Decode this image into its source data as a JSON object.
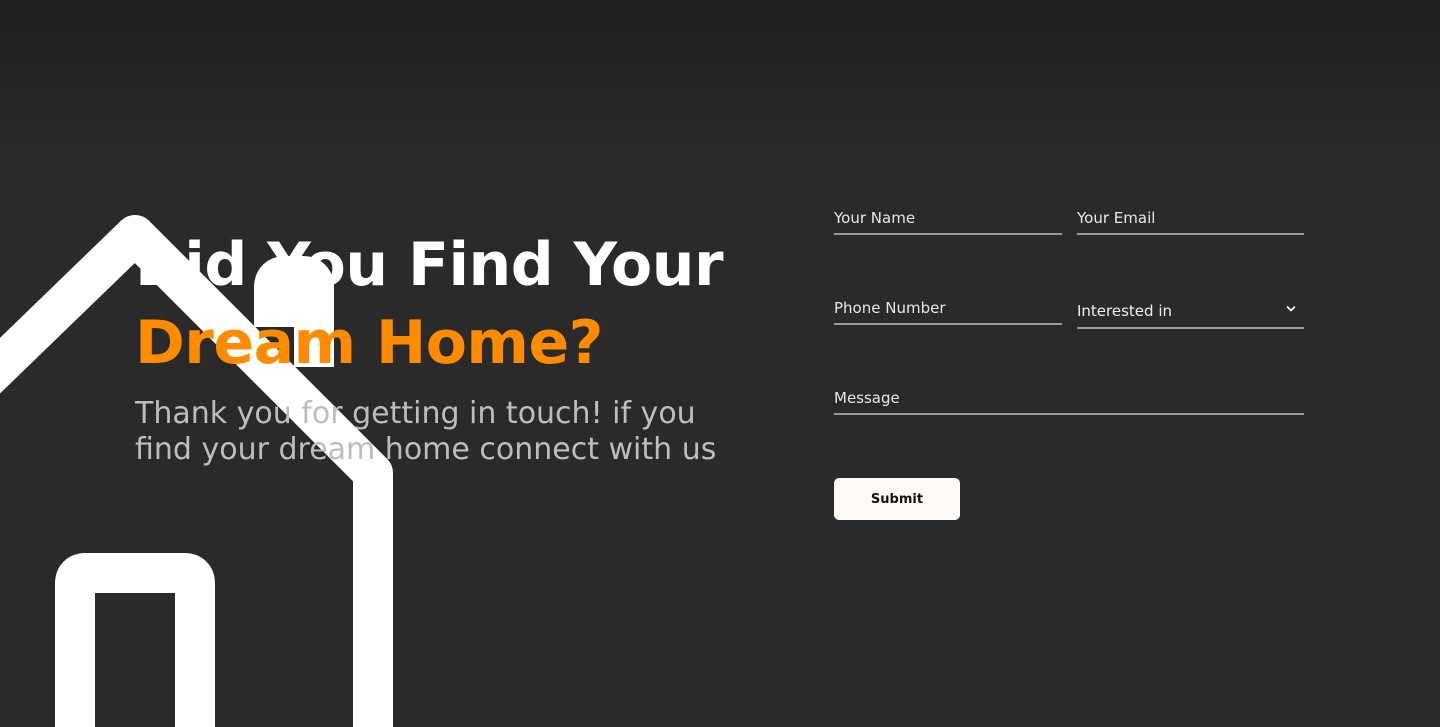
{
  "hero": {
    "headline_line1": "Did You Find Your",
    "headline_line2": "Dream Home?",
    "subtext": "Thank you for getting in touch! if you find your dream home connect with us"
  },
  "form": {
    "name_placeholder": "Your Name",
    "email_placeholder": "Your Email",
    "phone_placeholder": "Phone Number",
    "interest_label": "Interested in",
    "message_placeholder": "Message",
    "submit_label": "Submit"
  },
  "icons": {
    "house": "house-outline-icon",
    "dropdown": "chevron-down-icon"
  },
  "colors": {
    "background": "#2a2a2a",
    "accent": "#ff8c00",
    "headline": "#ffffff",
    "subtext": "#bdbdbd",
    "button": "#fffaf8"
  }
}
